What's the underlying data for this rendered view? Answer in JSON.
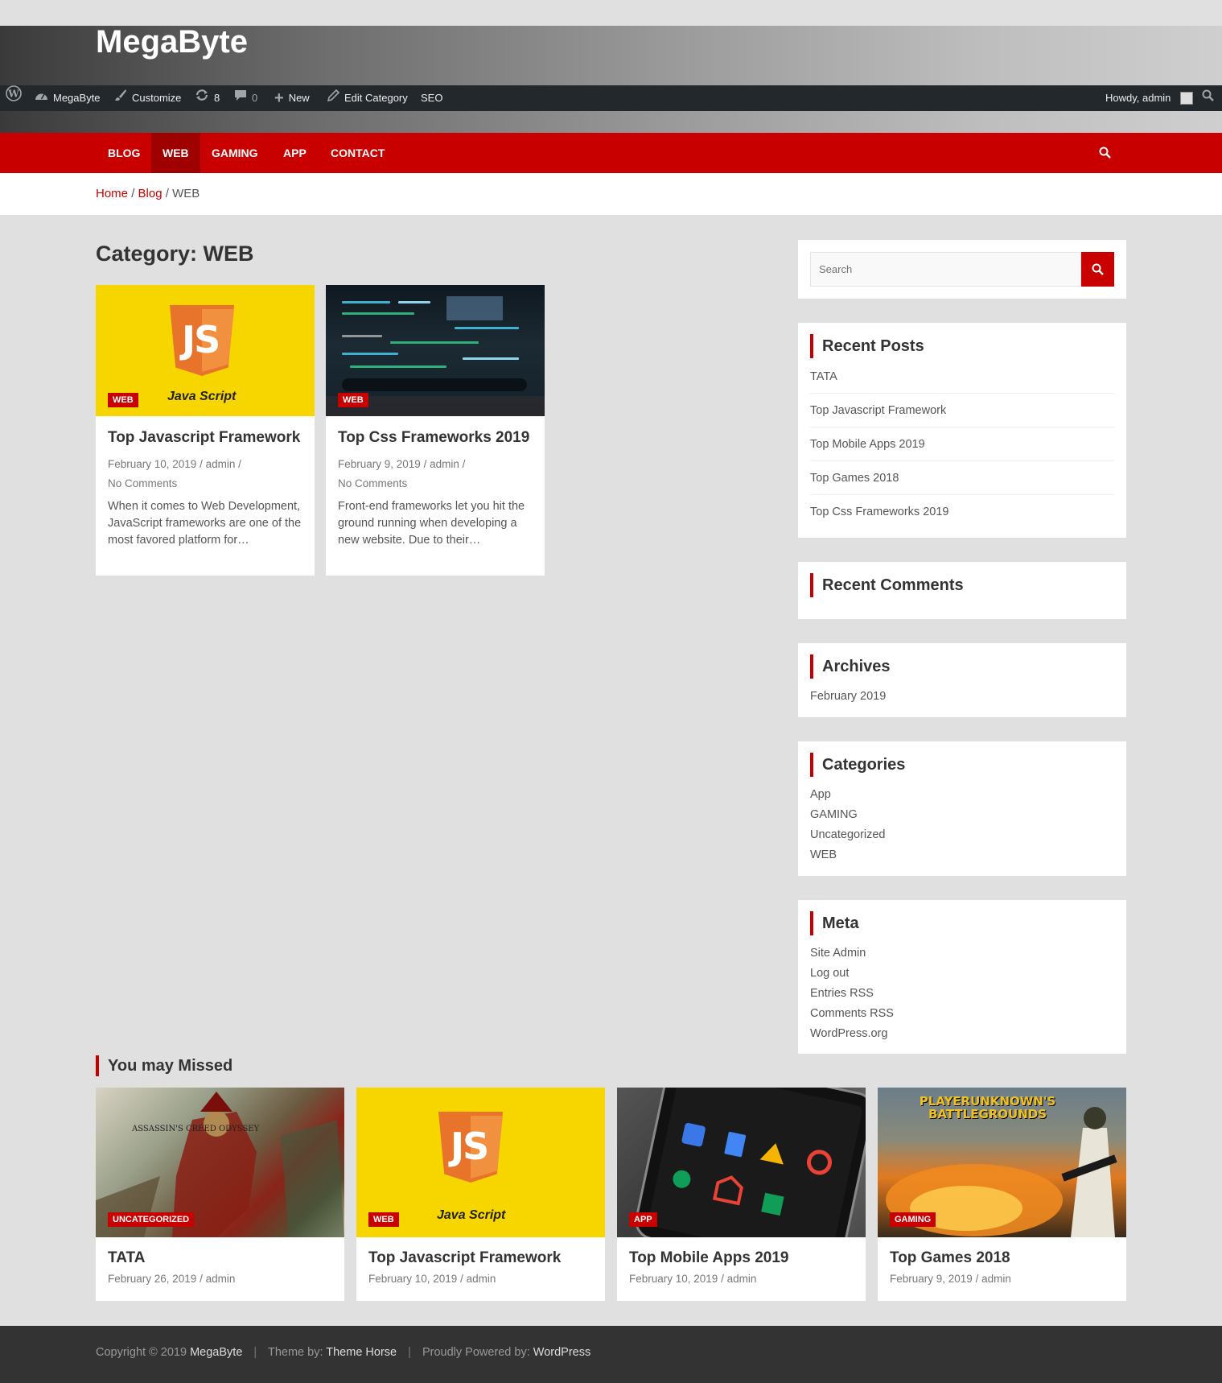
{
  "site": {
    "title": "MegaByte"
  },
  "admin_bar": {
    "site_name": "MegaByte",
    "customize": "Customize",
    "updates_count": "8",
    "comments_count": "0",
    "new_label": "New",
    "edit_category": "Edit Category",
    "seo": "SEO",
    "howdy": "Howdy, admin"
  },
  "nav": {
    "items": [
      {
        "label": "BLOG"
      },
      {
        "label": "WEB"
      },
      {
        "label": "GAMING"
      },
      {
        "label": "APP"
      },
      {
        "label": "CONTACT"
      }
    ],
    "active": "WEB"
  },
  "breadcrumb": {
    "home": "Home",
    "blog": "Blog",
    "current": "WEB",
    "separator": "/"
  },
  "page": {
    "category_title": "Category: WEB"
  },
  "posts": [
    {
      "badge": "WEB",
      "image_caption": "Java Script",
      "logo_text": "JS",
      "title": "Top Javascript Framework",
      "date": "February 10, 2019",
      "author": "admin",
      "comments": "No Comments",
      "excerpt": "When it comes to Web Development, JavaScript frameworks are one of the most favored platform for…"
    },
    {
      "badge": "WEB",
      "title": "Top Css Frameworks 2019",
      "date": "February 9, 2019",
      "author": "admin",
      "comments": "No Comments",
      "excerpt": "Front-end frameworks let you hit the ground running when developing a new website. Due to their…"
    }
  ],
  "sidebar": {
    "search": {
      "placeholder": "Search"
    },
    "recent_posts": {
      "title": "Recent Posts",
      "items": [
        "TATA",
        "Top Javascript Framework",
        "Top Mobile Apps 2019",
        "Top Games 2018",
        "Top Css Frameworks 2019"
      ]
    },
    "recent_comments": {
      "title": "Recent Comments"
    },
    "archives": {
      "title": "Archives",
      "items": [
        "February 2019"
      ]
    },
    "categories": {
      "title": "Categories",
      "items": [
        "App",
        "GAMING",
        "Uncategorized",
        "WEB"
      ]
    },
    "meta": {
      "title": "Meta",
      "items": [
        "Site Admin",
        "Log out",
        "Entries RSS",
        "Comments RSS",
        "WordPress.org"
      ]
    }
  },
  "missed": {
    "title": "You may Missed",
    "items": [
      {
        "badge": "UNCATEGORIZED",
        "title": "TATA",
        "date": "February 26, 2019",
        "author": "admin",
        "image_text": "ASSASSIN'S CREED ODYSSEY"
      },
      {
        "badge": "WEB",
        "title": "Top Javascript Framework",
        "date": "February 10, 2019",
        "author": "admin",
        "image_caption": "Java Script",
        "logo_text": "JS"
      },
      {
        "badge": "APP",
        "title": "Top Mobile Apps 2019",
        "date": "February 10, 2019",
        "author": "admin"
      },
      {
        "badge": "GAMING",
        "title": "Top Games 2018",
        "date": "February 9, 2019",
        "author": "admin",
        "image_text": "PLAYERUNKNOWN'S BATTLEGROUNDS"
      }
    ]
  },
  "footer": {
    "copyright": "Copyright © 2019",
    "site": "MegaByte",
    "theme_label": "Theme by:",
    "theme": "Theme Horse",
    "powered_label": "Proudly Powered by:",
    "powered": "WordPress",
    "separator": "|"
  },
  "colors": {
    "accent": "#c80000",
    "accent_dark": "#9f0000",
    "admin_bar": "#23282d",
    "footer": "#333333"
  },
  "icons": {
    "wordpress": "wordpress-icon",
    "dashboard": "dashboard-icon",
    "customize": "brush-icon",
    "updates": "refresh-icon",
    "comments": "comment-icon",
    "new": "plus-icon",
    "edit": "pencil-icon",
    "search": "search-icon"
  }
}
